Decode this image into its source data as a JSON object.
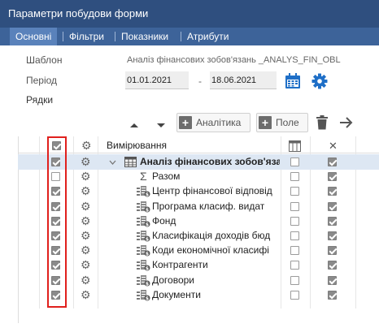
{
  "window": {
    "title": "Параметри побудови форми"
  },
  "tabs": [
    {
      "label": "Основні",
      "active": true
    },
    {
      "label": "Фільтри",
      "active": false
    },
    {
      "label": "Показники",
      "active": false
    },
    {
      "label": "Атрибути",
      "active": false
    }
  ],
  "form": {
    "template_label": "Шаблон",
    "template_value": "Аналіз фінансових зобов'язань _ANALYS_FIN_OBL",
    "period_label": "Період",
    "date_from": "01.01.2021",
    "date_sep": "-",
    "date_to": "18.06.2021",
    "rows_label": "Рядки"
  },
  "toolbar": {
    "analytics_label": "Аналітика",
    "field_label": "Поле"
  },
  "grid": {
    "header_label": "Вимірювання",
    "rows": [
      {
        "label": "Аналіз фінансових зобов'яза",
        "type": "table",
        "checked": true,
        "col1": false,
        "col2": true,
        "bold": true,
        "selected": true
      },
      {
        "label": "Разом",
        "type": "sigma",
        "checked": false,
        "col1": false,
        "col2": true
      },
      {
        "label": "Центр фінансової відповід",
        "type": "dim",
        "checked": true,
        "col1": false,
        "col2": true
      },
      {
        "label": "Програма класиф. видат",
        "type": "dim",
        "checked": true,
        "col1": false,
        "col2": true
      },
      {
        "label": "Фонд",
        "type": "dim",
        "checked": true,
        "col1": false,
        "col2": true
      },
      {
        "label": "Класифікація доходів бюд",
        "type": "dim",
        "checked": true,
        "col1": false,
        "col2": true
      },
      {
        "label": "Коди економічної класифі",
        "type": "dim",
        "checked": true,
        "col1": false,
        "col2": true
      },
      {
        "label": "Контрагенти",
        "type": "dim",
        "checked": true,
        "col1": false,
        "col2": true
      },
      {
        "label": "Договори",
        "type": "dim",
        "checked": true,
        "col1": false,
        "col2": true
      },
      {
        "label": "Документи",
        "type": "dim",
        "checked": true,
        "col1": false,
        "col2": true
      }
    ]
  },
  "colors": {
    "title_bar": "#2f4f7f",
    "tab_bar": "#3d6399",
    "accent": "#1f6fc7",
    "highlight": "#e0201d"
  }
}
